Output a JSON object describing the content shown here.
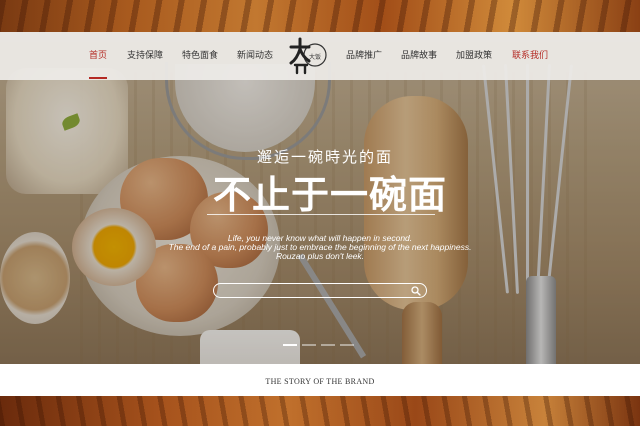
{
  "nav": {
    "items": [
      {
        "label": "首页"
      },
      {
        "label": "支持保障"
      },
      {
        "label": "特色面食"
      },
      {
        "label": "新闻动态"
      },
      {
        "label": "品牌推广"
      },
      {
        "label": "品牌故事"
      },
      {
        "label": "加盟政策"
      },
      {
        "label": "联系我们"
      }
    ],
    "active_index": 0,
    "accent_color": "#b42a24"
  },
  "logo": {
    "text_main": "大饭",
    "icon": "brand-logo"
  },
  "hero": {
    "subtitle": "邂逅一碗時光的面",
    "title": "不止于一碗面",
    "en_line1": "Life, you never know what will happen in second.",
    "en_line2": "The end of a pain, probably just to embrace the beginning of the next happiness.",
    "en_line3": "Rouzao plus don't leek.",
    "search": {
      "placeholder": "",
      "icon": "search-icon"
    },
    "slides_total": 4,
    "slide_active": 0
  },
  "section": {
    "story_title": "THE STORY OF THE BRAND"
  }
}
